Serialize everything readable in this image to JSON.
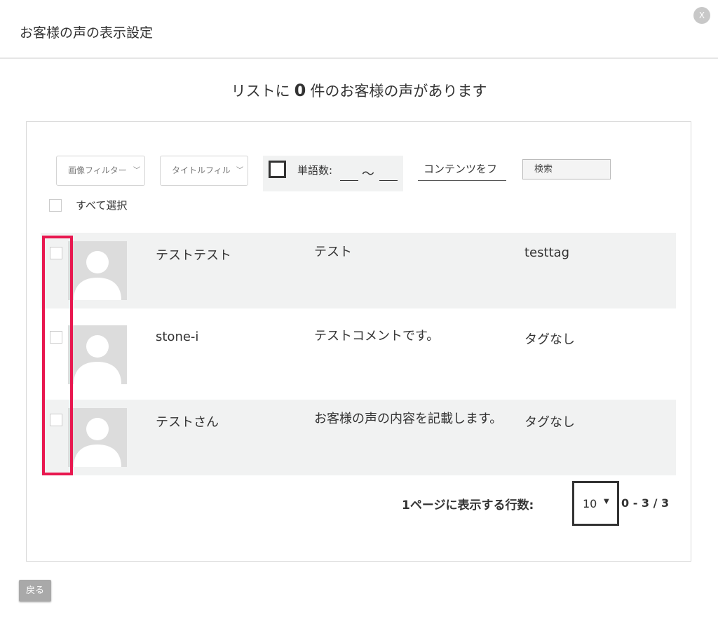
{
  "header": {
    "title": "お客様の声の表示設定",
    "close_label": "X"
  },
  "summary": {
    "prefix": "リストに",
    "count": "0",
    "suffix": "件のお客様の声があります"
  },
  "filters": {
    "image_filter": "画像フィルター",
    "title_filter": "タイトルフィル",
    "word_count_label": "単語数:",
    "word_count_separator": "～",
    "content_filter": "コンテンツをフ",
    "search_placeholder": "検索"
  },
  "select_all_label": "すべて選択",
  "rows": [
    {
      "name": "テストテスト",
      "comment": "テスト",
      "tag": "testtag"
    },
    {
      "name": "stone-i",
      "comment": "テストコメントです。",
      "tag": "タグなし"
    },
    {
      "name": "テストさん",
      "comment": "お客様の声の内容を記載します。",
      "tag": "タグなし"
    }
  ],
  "pagination": {
    "rows_per_page_label": "1ページに表示する行数:",
    "rows_per_page_value": "10",
    "range": "0 - 3 / 3"
  },
  "footer": {
    "back_label": "戻る"
  },
  "colors": {
    "highlight": "#e8174f",
    "row_alt": "#f1f2f2",
    "button_gray": "#a9a9a9"
  },
  "icons": {
    "avatar": "user-placeholder-icon",
    "chevron": "chevron-down-icon",
    "caret": "caret-down-icon",
    "close": "close-icon"
  }
}
